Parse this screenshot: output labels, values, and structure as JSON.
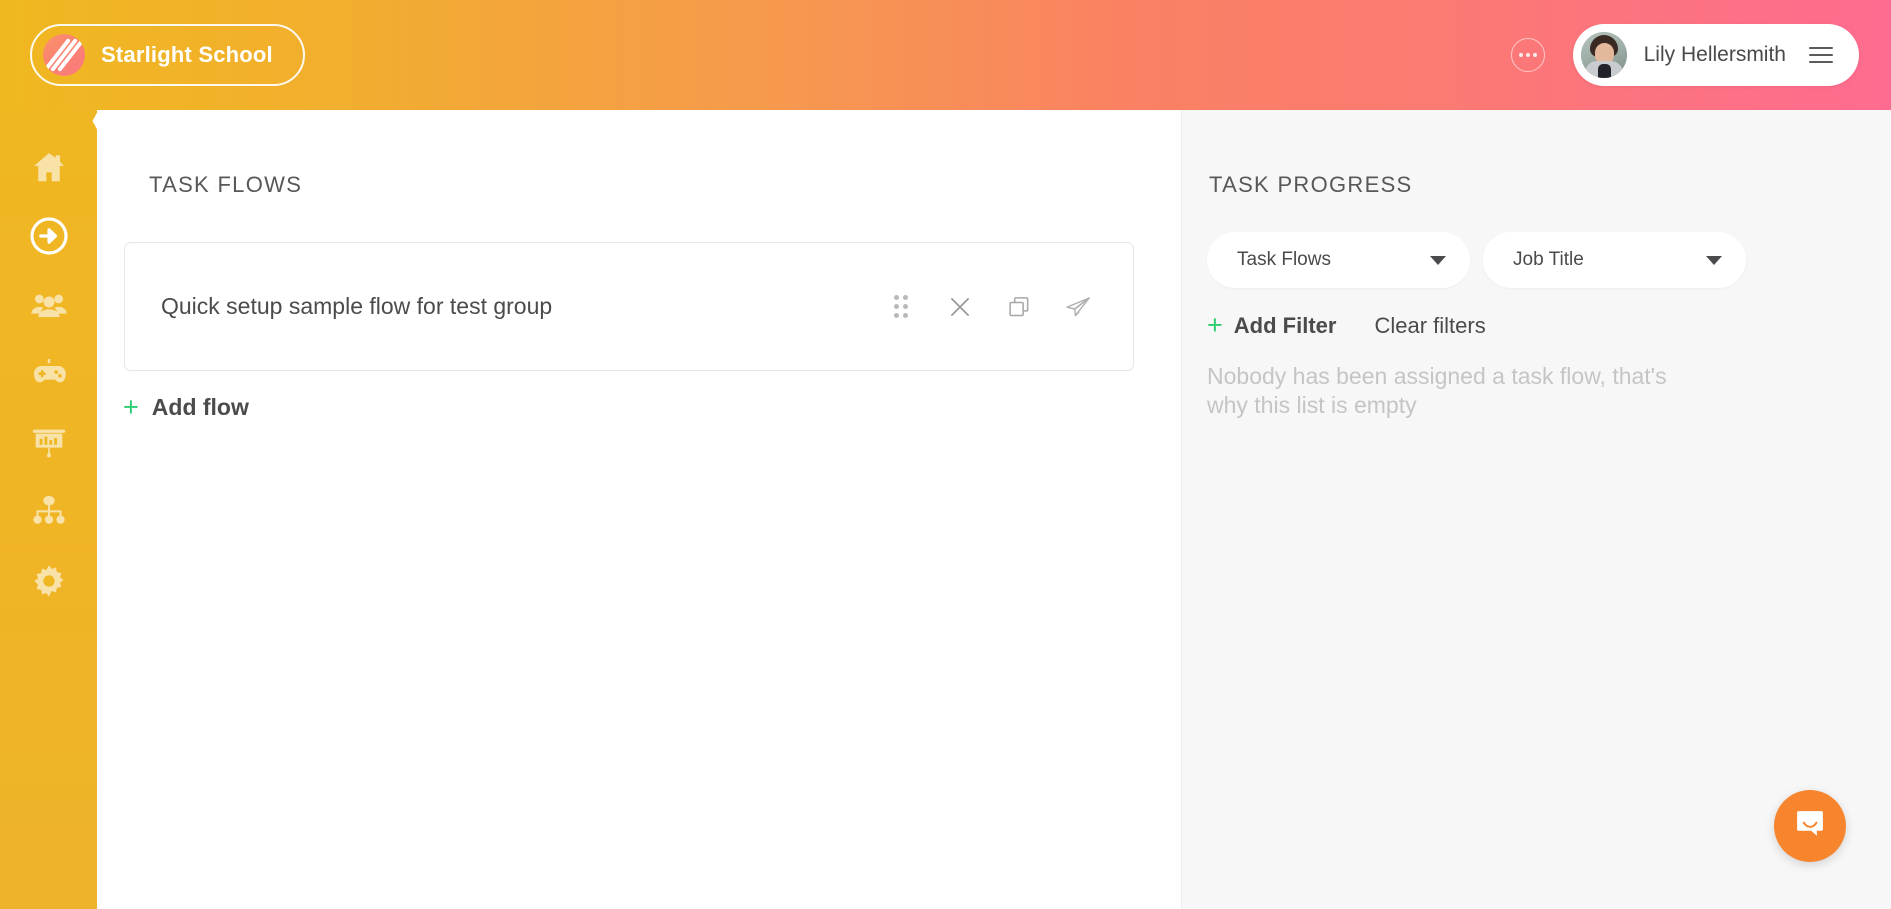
{
  "topbar": {
    "brand_name": "Starlight School",
    "logo_icon": "diagonal-stripes-logo",
    "more_icon": "ellipsis-icon",
    "user_name": "Lily Hellersmith",
    "avatar_icon": "user-avatar",
    "menu_icon": "hamburger-menu-icon",
    "accent_start": "#f0b820",
    "accent_end": "#fe6b90"
  },
  "sidebar": {
    "background": "#efb722",
    "collapse_icon": "chevron-left-icon",
    "items": [
      {
        "name": "home",
        "icon": "home-icon",
        "active": false
      },
      {
        "name": "task-flows",
        "icon": "arrow-right-circle-icon",
        "active": true
      },
      {
        "name": "people",
        "icon": "users-group-icon",
        "active": false
      },
      {
        "name": "games",
        "icon": "gamepad-icon",
        "active": false
      },
      {
        "name": "reports",
        "icon": "presentation-chart-icon",
        "active": false
      },
      {
        "name": "organization",
        "icon": "org-chart-icon",
        "active": false
      },
      {
        "name": "settings",
        "icon": "gear-icon",
        "active": false
      }
    ]
  },
  "task_flows": {
    "title": "TASK FLOWS",
    "flows": [
      {
        "name": "Quick setup sample flow for test group",
        "actions": [
          {
            "name": "drag-handle",
            "icon": "drag-handle-icon"
          },
          {
            "name": "remove",
            "icon": "close-x-icon"
          },
          {
            "name": "duplicate",
            "icon": "copy-icon"
          },
          {
            "name": "send",
            "icon": "paper-plane-icon"
          }
        ]
      }
    ],
    "add_flow_label": "Add flow",
    "add_flow_icon": "plus-icon",
    "plus_color": "#2ecc71"
  },
  "task_progress": {
    "title": "TASK PROGRESS",
    "filters": [
      {
        "name": "task-flows-filter",
        "label": "Task Flows",
        "icon": "chevron-down-icon"
      },
      {
        "name": "job-title-filter",
        "label": "Job Title",
        "icon": "chevron-down-icon"
      }
    ],
    "add_filter_label": "Add Filter",
    "add_filter_icon": "plus-icon",
    "clear_filters_label": "Clear filters",
    "empty_message": "Nobody has been assigned a task flow, that's why this list is empty"
  },
  "chat": {
    "icon": "chat-bubble-icon",
    "color": "#f6852e"
  }
}
